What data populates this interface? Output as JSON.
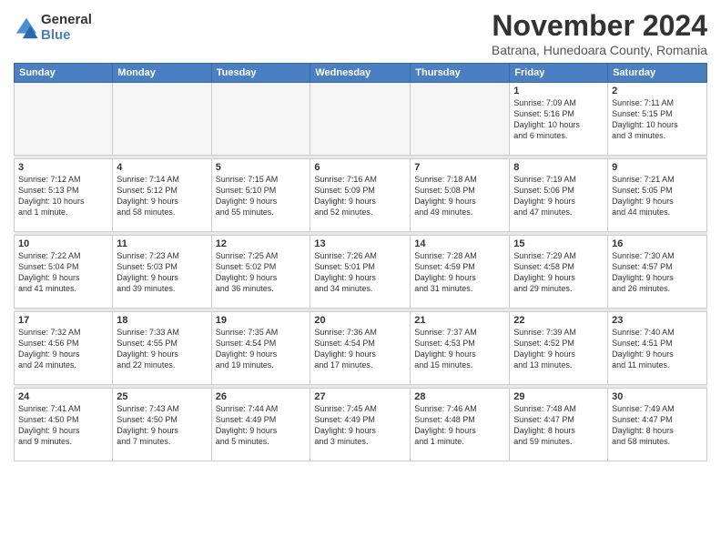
{
  "header": {
    "logo_line1": "General",
    "logo_line2": "Blue",
    "month_title": "November 2024",
    "subtitle": "Batrana, Hunedoara County, Romania"
  },
  "weekdays": [
    "Sunday",
    "Monday",
    "Tuesday",
    "Wednesday",
    "Thursday",
    "Friday",
    "Saturday"
  ],
  "weeks": [
    [
      {
        "day": "",
        "info": ""
      },
      {
        "day": "",
        "info": ""
      },
      {
        "day": "",
        "info": ""
      },
      {
        "day": "",
        "info": ""
      },
      {
        "day": "",
        "info": ""
      },
      {
        "day": "1",
        "info": "Sunrise: 7:09 AM\nSunset: 5:16 PM\nDaylight: 10 hours\nand 6 minutes."
      },
      {
        "day": "2",
        "info": "Sunrise: 7:11 AM\nSunset: 5:15 PM\nDaylight: 10 hours\nand 3 minutes."
      }
    ],
    [
      {
        "day": "3",
        "info": "Sunrise: 7:12 AM\nSunset: 5:13 PM\nDaylight: 10 hours\nand 1 minute."
      },
      {
        "day": "4",
        "info": "Sunrise: 7:14 AM\nSunset: 5:12 PM\nDaylight: 9 hours\nand 58 minutes."
      },
      {
        "day": "5",
        "info": "Sunrise: 7:15 AM\nSunset: 5:10 PM\nDaylight: 9 hours\nand 55 minutes."
      },
      {
        "day": "6",
        "info": "Sunrise: 7:16 AM\nSunset: 5:09 PM\nDaylight: 9 hours\nand 52 minutes."
      },
      {
        "day": "7",
        "info": "Sunrise: 7:18 AM\nSunset: 5:08 PM\nDaylight: 9 hours\nand 49 minutes."
      },
      {
        "day": "8",
        "info": "Sunrise: 7:19 AM\nSunset: 5:06 PM\nDaylight: 9 hours\nand 47 minutes."
      },
      {
        "day": "9",
        "info": "Sunrise: 7:21 AM\nSunset: 5:05 PM\nDaylight: 9 hours\nand 44 minutes."
      }
    ],
    [
      {
        "day": "10",
        "info": "Sunrise: 7:22 AM\nSunset: 5:04 PM\nDaylight: 9 hours\nand 41 minutes."
      },
      {
        "day": "11",
        "info": "Sunrise: 7:23 AM\nSunset: 5:03 PM\nDaylight: 9 hours\nand 39 minutes."
      },
      {
        "day": "12",
        "info": "Sunrise: 7:25 AM\nSunset: 5:02 PM\nDaylight: 9 hours\nand 36 minutes."
      },
      {
        "day": "13",
        "info": "Sunrise: 7:26 AM\nSunset: 5:01 PM\nDaylight: 9 hours\nand 34 minutes."
      },
      {
        "day": "14",
        "info": "Sunrise: 7:28 AM\nSunset: 4:59 PM\nDaylight: 9 hours\nand 31 minutes."
      },
      {
        "day": "15",
        "info": "Sunrise: 7:29 AM\nSunset: 4:58 PM\nDaylight: 9 hours\nand 29 minutes."
      },
      {
        "day": "16",
        "info": "Sunrise: 7:30 AM\nSunset: 4:57 PM\nDaylight: 9 hours\nand 26 minutes."
      }
    ],
    [
      {
        "day": "17",
        "info": "Sunrise: 7:32 AM\nSunset: 4:56 PM\nDaylight: 9 hours\nand 24 minutes."
      },
      {
        "day": "18",
        "info": "Sunrise: 7:33 AM\nSunset: 4:55 PM\nDaylight: 9 hours\nand 22 minutes."
      },
      {
        "day": "19",
        "info": "Sunrise: 7:35 AM\nSunset: 4:54 PM\nDaylight: 9 hours\nand 19 minutes."
      },
      {
        "day": "20",
        "info": "Sunrise: 7:36 AM\nSunset: 4:54 PM\nDaylight: 9 hours\nand 17 minutes."
      },
      {
        "day": "21",
        "info": "Sunrise: 7:37 AM\nSunset: 4:53 PM\nDaylight: 9 hours\nand 15 minutes."
      },
      {
        "day": "22",
        "info": "Sunrise: 7:39 AM\nSunset: 4:52 PM\nDaylight: 9 hours\nand 13 minutes."
      },
      {
        "day": "23",
        "info": "Sunrise: 7:40 AM\nSunset: 4:51 PM\nDaylight: 9 hours\nand 11 minutes."
      }
    ],
    [
      {
        "day": "24",
        "info": "Sunrise: 7:41 AM\nSunset: 4:50 PM\nDaylight: 9 hours\nand 9 minutes."
      },
      {
        "day": "25",
        "info": "Sunrise: 7:43 AM\nSunset: 4:50 PM\nDaylight: 9 hours\nand 7 minutes."
      },
      {
        "day": "26",
        "info": "Sunrise: 7:44 AM\nSunset: 4:49 PM\nDaylight: 9 hours\nand 5 minutes."
      },
      {
        "day": "27",
        "info": "Sunrise: 7:45 AM\nSunset: 4:49 PM\nDaylight: 9 hours\nand 3 minutes."
      },
      {
        "day": "28",
        "info": "Sunrise: 7:46 AM\nSunset: 4:48 PM\nDaylight: 9 hours\nand 1 minute."
      },
      {
        "day": "29",
        "info": "Sunrise: 7:48 AM\nSunset: 4:47 PM\nDaylight: 8 hours\nand 59 minutes."
      },
      {
        "day": "30",
        "info": "Sunrise: 7:49 AM\nSunset: 4:47 PM\nDaylight: 8 hours\nand 58 minutes."
      }
    ]
  ]
}
